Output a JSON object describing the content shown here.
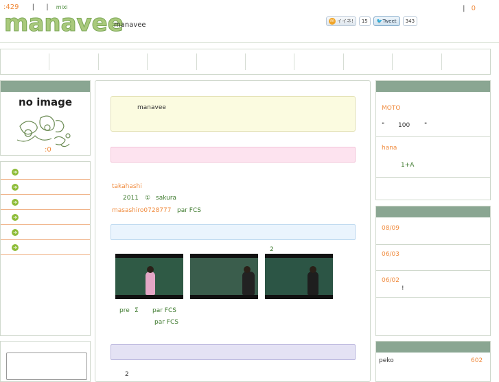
{
  "header": {
    "counter": ":429",
    "sep1": "|",
    "sep2": "|",
    "mixi": "mixi",
    "right_sep": "|",
    "right_count": "0",
    "logo": "manavee",
    "site_name": "manavee"
  },
  "social": {
    "mixi_like_label": "イイネ!",
    "like_count": "15",
    "tweet_label": "Tweet",
    "tweet_count": "343"
  },
  "profile": {
    "no_image_label": "no image",
    "count": ":0"
  },
  "notice": {
    "text": "manavee"
  },
  "activity": {
    "user1": "takahashi",
    "line2_year": "2011",
    "line2_symbol": "①",
    "line2_user": "sakura",
    "user3": "masashiro0728777",
    "line3_tail": "par FCS"
  },
  "videos": {
    "caption_2": "2",
    "below1_a": "pre",
    "below1_b": "Σ",
    "below1_c": "par FCS",
    "below2": "par FCS",
    "bottom_char": "2"
  },
  "right_panel1": {
    "item1_name": "MOTO",
    "item1_text_a": "\"",
    "item1_text_b": "100",
    "item1_text_c": "\"",
    "item2_name": "hana",
    "item2_text": "1+A"
  },
  "right_panel2": {
    "date1": "08/09",
    "date2": "06/03",
    "date3": "06/02",
    "date3_text": "!"
  },
  "right_panel3": {
    "name": "peko",
    "count": "602"
  },
  "colors": {
    "accent_orange": "#f08a3c",
    "panel_header_green": "#8aa692",
    "logo_green": "#a9c97c"
  }
}
